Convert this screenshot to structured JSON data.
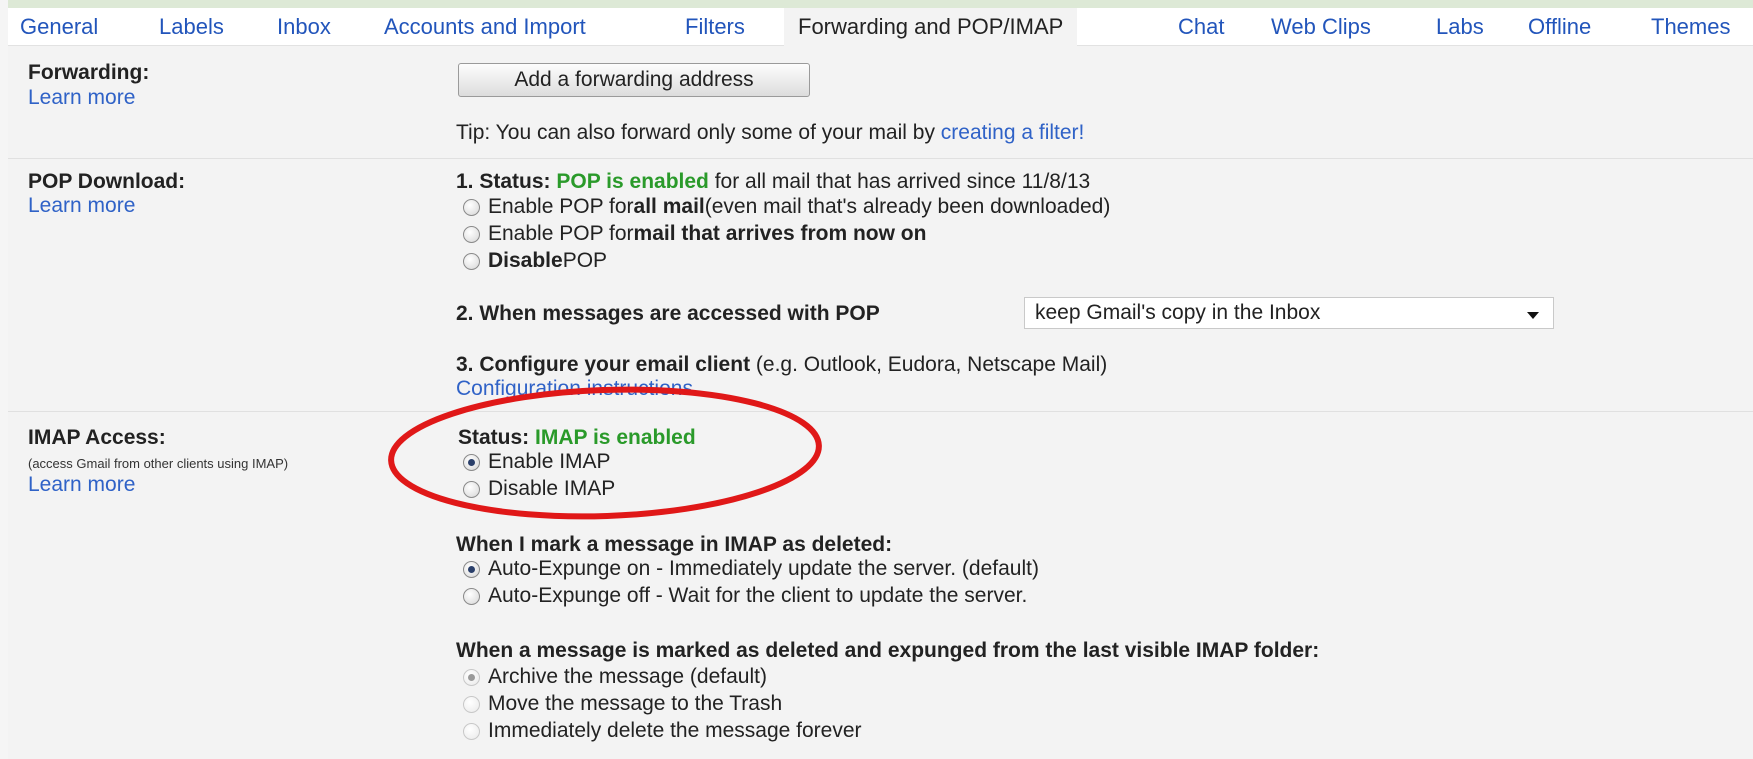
{
  "tabs": [
    "General",
    "Labels",
    "Inbox",
    "Accounts and Import",
    "Filters",
    "Forwarding and POP/IMAP",
    "Chat",
    "Web Clips",
    "Labs",
    "Offline",
    "Themes"
  ],
  "forwarding": {
    "label": "Forwarding:",
    "learn_more": "Learn more",
    "button": "Add a forwarding address",
    "tip_text": "Tip: You can also forward only some of your mail by ",
    "tip_link": "creating a filter!"
  },
  "pop": {
    "label": "POP Download:",
    "learn_more": "Learn more",
    "status_prefix": "1. Status: ",
    "status_value": "POP is enabled",
    "status_suffix": " for all mail that has arrived since 11/8/13",
    "opt1_a": "Enable POP for ",
    "opt1_b": "all mail",
    "opt1_c": " (even mail that's already been downloaded)",
    "opt2_a": "Enable POP for ",
    "opt2_b": "mail that arrives from now on",
    "opt3_a": "Disable",
    "opt3_b": " POP",
    "access_label": "2. When messages are accessed with POP",
    "access_value": "keep Gmail's copy in the Inbox",
    "configure_bold": "3. Configure your email client",
    "configure_rest": " (e.g. Outlook, Eudora, Netscape Mail)",
    "config_link": "Configuration instructions"
  },
  "imap": {
    "label": "IMAP Access:",
    "sublabel": "(access Gmail from other clients using IMAP)",
    "learn_more": "Learn more",
    "status_prefix": "Status: ",
    "status_value": "IMAP is enabled",
    "enable": "Enable IMAP",
    "disable": "Disable IMAP",
    "deleted_heading": "When I mark a message in IMAP as deleted:",
    "expunge_on": "Auto-Expunge on - Immediately update the server. (default)",
    "expunge_off": "Auto-Expunge off - Wait for the client to update the server.",
    "expunged_heading": "When a message is marked as deleted and expunged from the last visible IMAP folder:",
    "archive": "Archive the message (default)",
    "trash": "Move the message to the Trash",
    "delete_forever": "Immediately delete the message forever"
  },
  "colors": {
    "link": "#2f62c7",
    "status_green": "#2a9a2a",
    "annotation_red": "#e01818"
  }
}
